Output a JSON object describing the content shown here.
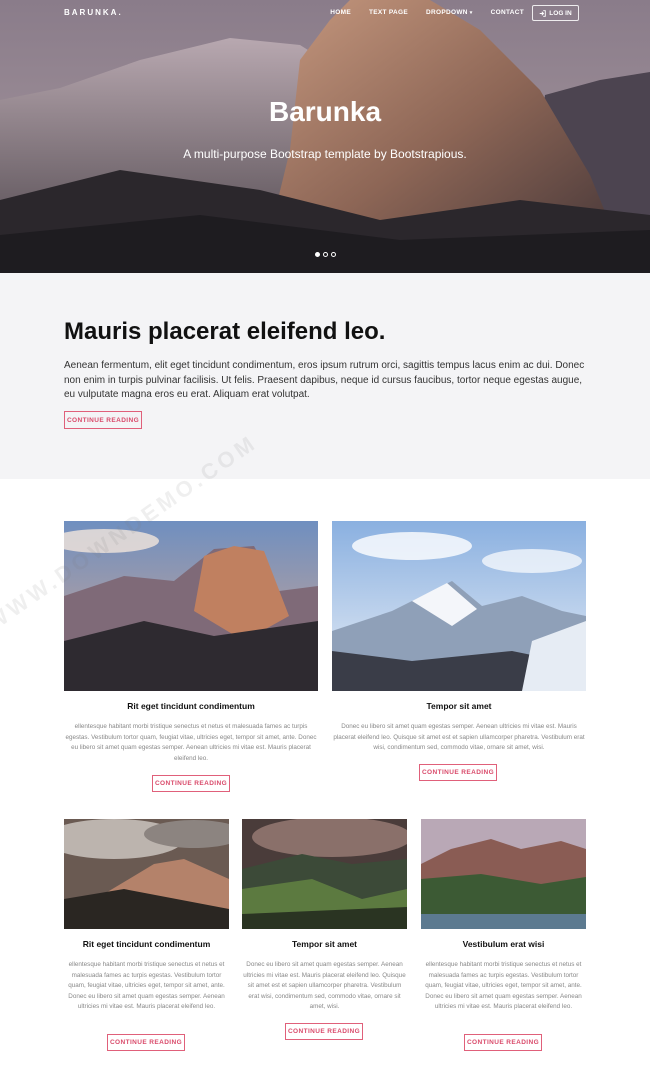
{
  "nav": {
    "brand": "BARUNKA.",
    "links": [
      "HOME",
      "TEXT PAGE",
      "DROPDOWN",
      "CONTACT"
    ],
    "dropdown_caret": "▾",
    "login_label": "LOG IN",
    "login_icon": "sign-in-icon"
  },
  "hero": {
    "title": "Barunka",
    "subtitle": "A multi-purpose Bootstrap template by Bootstrapious.",
    "slides": 3,
    "active_slide": 1
  },
  "intro": {
    "heading": "Mauris placerat eleifend leo.",
    "text": "Aenean fermentum, elit eget tincidunt condimentum, eros ipsum rutrum orci, sagittis tempus lacus enim ac dui. Donec non enim in turpis pulvinar facilisis. Ut felis. Praesent dapibus, neque id cursus faucibus, tortor neque egestas augue, eu vulputate magna eros eu erat. Aliquam erat volutpat.",
    "button": "CONTINUE READING"
  },
  "cards_row1": [
    {
      "title": "Rit eget tincidunt condimentum",
      "text": "ellentesque habitant morbi tristique senectus et netus et malesuada fames ac turpis egestas. Vestibulum tortor quam, feugiat vitae, ultricies eget, tempor sit amet, ante. Donec eu libero sit amet quam egestas semper. Aenean ultricies mi vitae est. Mauris placerat eleifend leo.",
      "button": "CONTINUE READING"
    },
    {
      "title": "Tempor sit amet",
      "text": "Donec eu libero sit amet quam egestas semper. Aenean ultricies mi vitae est. Mauris placerat eleifend leo. Quisque sit amet est et sapien ullamcorper pharetra. Vestibulum erat wisi, condimentum sed, commodo vitae, ornare sit amet, wisi.",
      "button": "CONTINUE READING"
    }
  ],
  "cards_row2": [
    {
      "title": "Rit eget tincidunt condimentum",
      "text": "ellentesque habitant morbi tristique senectus et netus et malesuada fames ac turpis egestas. Vestibulum tortor quam, feugiat vitae, ultricies eget, tempor sit amet, ante. Donec eu libero sit amet quam egestas semper. Aenean ultricies mi vitae est. Mauris placerat eleifend leo.",
      "button": "CONTINUE READING"
    },
    {
      "title": "Tempor sit amet",
      "text": "Donec eu libero sit amet quam egestas semper. Aenean ultricies mi vitae est. Mauris placerat eleifend leo. Quisque sit amet est et sapien ullamcorper pharetra. Vestibulum erat wisi, condimentum sed, commodo vitae, ornare sit amet, wisi.",
      "button": "CONTINUE READING"
    },
    {
      "title": "Vestibulum erat wisi",
      "text": "ellentesque habitant morbi tristique senectus et netus et malesuada fames ac turpis egestas. Vestibulum tortor quam, feugiat vitae, ultricies eget, tempor sit amet, ante. Donec eu libero sit amet quam egestas semper. Aenean ultricies mi vitae est. Mauris placerat eleifend leo.",
      "button": "CONTINUE READING"
    }
  ],
  "colors": {
    "accent": "#d94a6a",
    "intro_bg": "#f4f4f6"
  },
  "watermark": "WWW.DOWNDEMO.COM"
}
